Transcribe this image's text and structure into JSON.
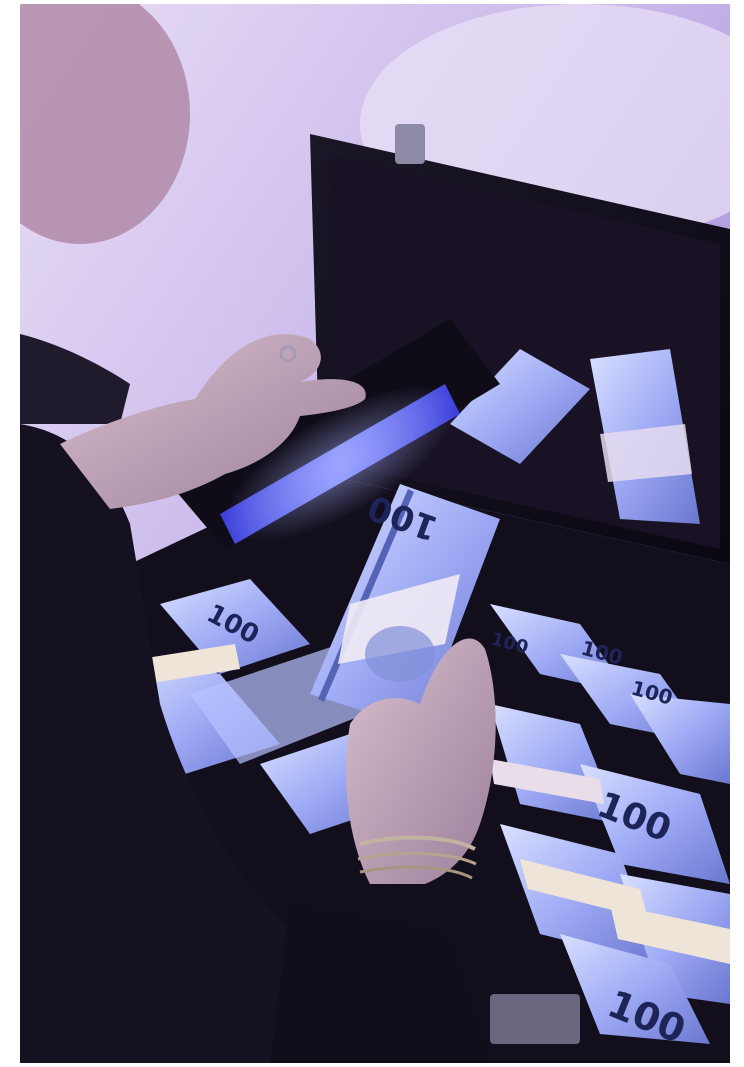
{
  "photo": {
    "colors": {
      "background_light": "#d9c8ef",
      "background_purple": "#8f78c9",
      "briefcase": "#0e0b18",
      "briefcase_lining": "#1a1428",
      "bill_light": "#c9d3ff",
      "bill_mid": "#8e9df0",
      "bill_dark": "#4c58a6",
      "band": "#e6dcf0",
      "skin": "#c9aeb9",
      "uv_glow": "#6f7dff",
      "sleeve": "#151120"
    },
    "bills": [
      {
        "label": "100"
      },
      {
        "label": "100"
      },
      {
        "label": "100"
      },
      {
        "label": "100"
      },
      {
        "label": "100"
      },
      {
        "label": "100"
      },
      {
        "label": "100"
      }
    ]
  }
}
